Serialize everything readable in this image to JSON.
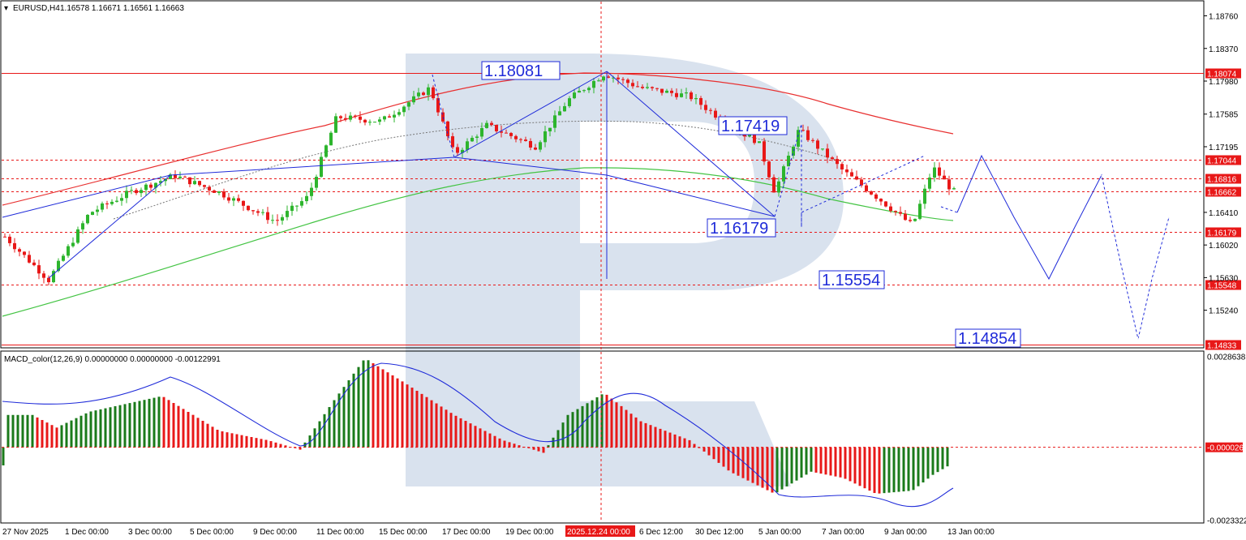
{
  "header": {
    "symbol": "EURUSD,H4",
    "ohlc": "1.16578 1.16671 1.16561 1.16663"
  },
  "macd_header": "MACD_color(12,26,9) 0.00000000 0.00000000 -0.00122991",
  "colors": {
    "bull": "#2db52d",
    "bear": "#e81818",
    "macd_up": "#1a7a1a",
    "macd_down": "#e81818",
    "forecast": "#1f2bd9",
    "level_red": "#e81818",
    "ma_red": "#e83030",
    "ma_green": "#44c444",
    "watermark": "#d9e2ee"
  },
  "time_axis": [
    "27 Nov 2025",
    "1 Dec 00:00",
    "3 Dec 00:00",
    "5 Dec 00:00",
    "9 Dec 00:00",
    "11 Dec 00:00",
    "15 Dec 00:00",
    "17 Dec 00:00",
    "19 Dec 00:00",
    "2025.12.24 00:00",
    "6 Dec 12:00",
    "30 Dec 12:00",
    "5 Jan 00:00",
    "7 Jan 00:00",
    "9 Jan 00:00",
    "13 Jan 00:00"
  ],
  "chart_data": [
    {
      "type": "line",
      "title": "EURUSD,H4",
      "y_axis_ticks": [
        "1.18760",
        "1.18370",
        "1.17980",
        "1.17585",
        "1.17195",
        "1.16410",
        "1.16020",
        "1.15630",
        "1.15240"
      ],
      "ylim": [
        1.148,
        1.1893
      ],
      "price_levels": [
        {
          "value": 1.18074,
          "label": "1.18074",
          "style": "solid"
        },
        {
          "value": 1.17044,
          "label": "1.17044",
          "style": "dashed"
        },
        {
          "value": 1.16816,
          "label": "1.16816",
          "style": "dashed"
        },
        {
          "value": 1.16662,
          "label": "1.16662",
          "style": "dashed"
        },
        {
          "value": 1.16179,
          "label": "1.16179",
          "style": "dashed"
        },
        {
          "value": 1.15548,
          "label": "1.15548",
          "style": "dashed"
        },
        {
          "value": 1.14833,
          "label": "1.14833",
          "style": "solid"
        }
      ],
      "annotations": [
        "1.18081",
        "1.17419",
        "1.16179",
        "1.15554",
        "1.14854"
      ],
      "crosshair_date": "2025.12.24 00:00",
      "last_bar": {
        "open": 1.16578,
        "high": 1.16671,
        "low": 1.16561,
        "close": 1.16663
      }
    },
    {
      "type": "bar",
      "title": "MACD_color(12,26,9)",
      "y_axis_ticks": [
        "0.0028638",
        "-0.000026",
        "-0.0023322"
      ],
      "ylim": [
        -0.0024,
        0.003
      ],
      "last_value": -0.00122991
    }
  ]
}
